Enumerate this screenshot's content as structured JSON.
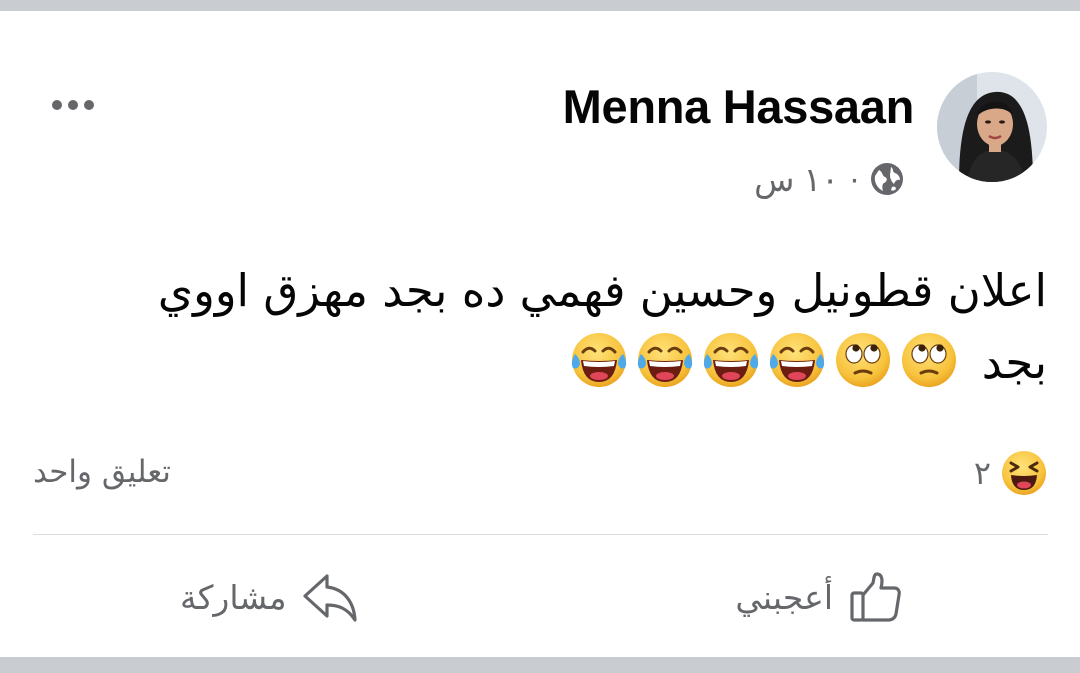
{
  "post": {
    "author": "Menna Hassaan",
    "time": "١٠ س",
    "separator": "·",
    "text_line_1": "اعلان قطونيل وحسين فهمي ده بجد مهزق اووي",
    "text_line_2": "بجد",
    "text_emojis": [
      "rolling-eyes",
      "rolling-eyes",
      "tears-of-joy",
      "tears-of-joy",
      "tears-of-joy",
      "tears-of-joy"
    ]
  },
  "reactions": {
    "icon": "haha-reaction",
    "count": "٢"
  },
  "comments_label": "تعليق واحد",
  "actions": {
    "like_label": "أعجبني",
    "share_label": "مشاركة"
  },
  "colors": {
    "text": "#050505",
    "secondary": "#65676b",
    "divider": "#dadde1",
    "frame": "#c9ccd1",
    "emoji_yellow": "#f7c23b"
  }
}
